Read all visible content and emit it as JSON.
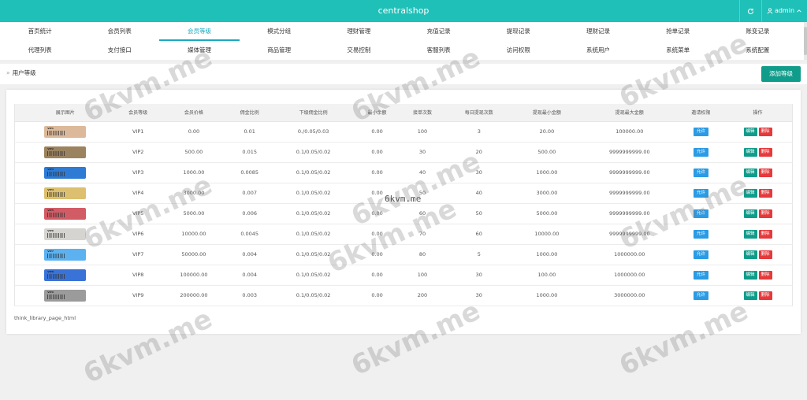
{
  "header": {
    "title": "centralshop",
    "user": "admin"
  },
  "menu": {
    "row1": [
      "首页统计",
      "会员列表",
      "会员等级",
      "模式分组",
      "理财管理",
      "充值记录",
      "提现记录",
      "理财记录",
      "抢单记录",
      "账变记录"
    ],
    "row2": [
      "代理列表",
      "支付接口",
      "媒体管理",
      "商品管理",
      "交易控制",
      "客服列表",
      "访问权限",
      "系统用户",
      "系统菜单",
      "系统配置"
    ],
    "active": "会员等级"
  },
  "breadcrumb": {
    "sep": "»",
    "current": "用户等级"
  },
  "actions": {
    "add_label": "添加等级"
  },
  "table": {
    "columns": [
      "展示图片",
      "会员等级",
      "会员价格",
      "佣金比例",
      "下级佣金比例",
      "最小余额",
      "接单次数",
      "每日提现次数",
      "提现最小金额",
      "提现最大金额",
      "邀请权限",
      "操作"
    ],
    "rows": [
      {
        "card": "VIP1",
        "card_color": "#dbb99a",
        "level": "VIP1",
        "price": "0.00",
        "commission": "0.01",
        "sub_commission": "0./0.05/0.03",
        "min_balance": "0.00",
        "orders": "100",
        "daily_withdrawals": "3",
        "withdraw_min": "20.00",
        "withdraw_max": "100000.00",
        "permission": "允许"
      },
      {
        "card": "VIP2",
        "card_color": "#9c835f",
        "level": "VIP2",
        "price": "500.00",
        "commission": "0.015",
        "sub_commission": "0.1/0.05/0.02",
        "min_balance": "0.00",
        "orders": "30",
        "daily_withdrawals": "20",
        "withdraw_min": "500.00",
        "withdraw_max": "9999999999.00",
        "permission": "允许"
      },
      {
        "card": "VIP3",
        "card_color": "#2d7bd4",
        "level": "VIP3",
        "price": "1000.00",
        "commission": "0.0085",
        "sub_commission": "0.1/0.05/0.02",
        "min_balance": "0.00",
        "orders": "40",
        "daily_withdrawals": "30",
        "withdraw_min": "1000.00",
        "withdraw_max": "9999999999.00",
        "permission": "允许"
      },
      {
        "card": "VIP4",
        "card_color": "#dcc070",
        "level": "VIP4",
        "price": "3000.00",
        "commission": "0.007",
        "sub_commission": "0.1/0.05/0.02",
        "min_balance": "0.00",
        "orders": "50",
        "daily_withdrawals": "40",
        "withdraw_min": "3000.00",
        "withdraw_max": "9999999999.00",
        "permission": "允许"
      },
      {
        "card": "VIP5",
        "card_color": "#d25c66",
        "level": "VIP5",
        "price": "5000.00",
        "commission": "0.006",
        "sub_commission": "0.1/0.05/0.02",
        "min_balance": "0.00",
        "orders": "60",
        "daily_withdrawals": "50",
        "withdraw_min": "5000.00",
        "withdraw_max": "9999999999.00",
        "permission": "允许"
      },
      {
        "card": "VIP6",
        "card_color": "#d5d4d0",
        "level": "VIP6",
        "price": "10000.00",
        "commission": "0.0045",
        "sub_commission": "0.1/0.05/0.02",
        "min_balance": "0.00",
        "orders": "70",
        "daily_withdrawals": "60",
        "withdraw_min": "10000.00",
        "withdraw_max": "9999999999.00",
        "permission": "允许"
      },
      {
        "card": "VIP7",
        "card_color": "#5cb2f1",
        "level": "VIP7",
        "price": "50000.00",
        "commission": "0.004",
        "sub_commission": "0.1/0.05/0.02",
        "min_balance": "0.00",
        "orders": "80",
        "daily_withdrawals": "5",
        "withdraw_min": "1000.00",
        "withdraw_max": "1000000.00",
        "permission": "允许"
      },
      {
        "card": "VIP8",
        "card_color": "#3a73d8",
        "level": "VIP8",
        "price": "100000.00",
        "commission": "0.004",
        "sub_commission": "0.1/0.05/0.02",
        "min_balance": "0.00",
        "orders": "100",
        "daily_withdrawals": "30",
        "withdraw_min": "100.00",
        "withdraw_max": "1000000.00",
        "permission": "允许"
      },
      {
        "card": "VIP9",
        "card_color": "#9b9b9b",
        "level": "VIP9",
        "price": "200000.00",
        "commission": "0.003",
        "sub_commission": "0.1/0.05/0.02",
        "min_balance": "0.00",
        "orders": "200",
        "daily_withdrawals": "30",
        "withdraw_min": "1000.00",
        "withdraw_max": "3000000.00",
        "permission": "允许"
      }
    ],
    "edit_label": "编辑",
    "delete_label": "删除"
  },
  "footer_text": "think_library_page_html",
  "watermark": {
    "text": "6kvm.me",
    "center_text": "6kvm.me"
  }
}
